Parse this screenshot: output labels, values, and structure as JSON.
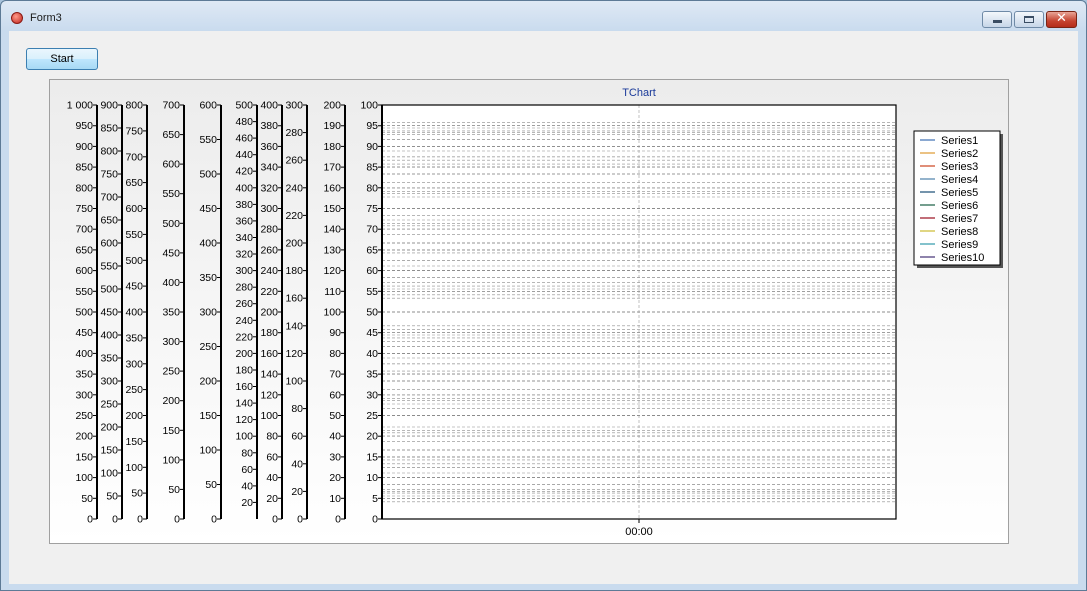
{
  "window": {
    "title": "Form3"
  },
  "toolbar": {
    "start_label": "Start"
  },
  "chart_data": {
    "type": "line",
    "title": "TChart",
    "x": [
      "00:00"
    ],
    "grid": true,
    "legend_position": "right",
    "axes": [
      {
        "name": "axis-1000",
        "labels": [
          "0",
          "50",
          "100",
          "150",
          "200",
          "250",
          "300",
          "350",
          "400",
          "450",
          "500",
          "550",
          "600",
          "650",
          "700",
          "750",
          "800",
          "850",
          "900",
          "950",
          "1 000"
        ]
      },
      {
        "name": "axis-900",
        "labels": [
          "0",
          "50",
          "100",
          "150",
          "200",
          "250",
          "300",
          "350",
          "400",
          "450",
          "500",
          "550",
          "600",
          "650",
          "700",
          "750",
          "800",
          "850",
          "900"
        ]
      },
      {
        "name": "axis-800",
        "labels": [
          "0",
          "50",
          "100",
          "150",
          "200",
          "250",
          "300",
          "350",
          "400",
          "450",
          "500",
          "550",
          "600",
          "650",
          "700",
          "750",
          "800"
        ]
      },
      {
        "name": "axis-700",
        "labels": [
          "0",
          "50",
          "100",
          "150",
          "200",
          "250",
          "300",
          "350",
          "400",
          "450",
          "500",
          "550",
          "600",
          "650",
          "700"
        ]
      },
      {
        "name": "axis-600",
        "labels": [
          "0",
          "50",
          "100",
          "150",
          "200",
          "250",
          "300",
          "350",
          "400",
          "450",
          "500",
          "550",
          "600"
        ]
      },
      {
        "name": "axis-500",
        "labels": [
          "20",
          "40",
          "60",
          "80",
          "100",
          "120",
          "140",
          "160",
          "180",
          "200",
          "220",
          "240",
          "260",
          "280",
          "300",
          "320",
          "340",
          "360",
          "380",
          "400",
          "420",
          "440",
          "460",
          "480",
          "500"
        ]
      },
      {
        "name": "axis-400",
        "labels": [
          "0",
          "20",
          "40",
          "60",
          "80",
          "100",
          "120",
          "140",
          "160",
          "180",
          "200",
          "220",
          "240",
          "260",
          "280",
          "300",
          "320",
          "340",
          "360",
          "380",
          "400"
        ]
      },
      {
        "name": "axis-300",
        "labels": [
          "0",
          "20",
          "40",
          "60",
          "80",
          "100",
          "120",
          "140",
          "160",
          "180",
          "200",
          "220",
          "240",
          "260",
          "280",
          "300"
        ]
      },
      {
        "name": "axis-200",
        "labels": [
          "0",
          "10",
          "20",
          "30",
          "40",
          "50",
          "60",
          "70",
          "80",
          "90",
          "100",
          "110",
          "120",
          "130",
          "140",
          "150",
          "160",
          "170",
          "180",
          "190",
          "200"
        ]
      },
      {
        "name": "axis-100",
        "labels": [
          "0",
          "5",
          "10",
          "15",
          "20",
          "25",
          "30",
          "35",
          "40",
          "45",
          "50",
          "55",
          "60",
          "65",
          "70",
          "75",
          "80",
          "85",
          "90",
          "95",
          "100"
        ]
      }
    ],
    "series": [
      {
        "name": "Series1",
        "color": "#4a7ab8",
        "values": []
      },
      {
        "name": "Series2",
        "color": "#e0a040",
        "values": []
      },
      {
        "name": "Series3",
        "color": "#d05030",
        "values": []
      },
      {
        "name": "Series4",
        "color": "#5a8ab0",
        "values": []
      },
      {
        "name": "Series5",
        "color": "#2a5a80",
        "values": []
      },
      {
        "name": "Series6",
        "color": "#2a6a50",
        "values": []
      },
      {
        "name": "Series7",
        "color": "#a02030",
        "values": []
      },
      {
        "name": "Series8",
        "color": "#d0c040",
        "values": []
      },
      {
        "name": "Series9",
        "color": "#40a0b0",
        "values": []
      },
      {
        "name": "Series10",
        "color": "#504080",
        "values": []
      }
    ]
  }
}
